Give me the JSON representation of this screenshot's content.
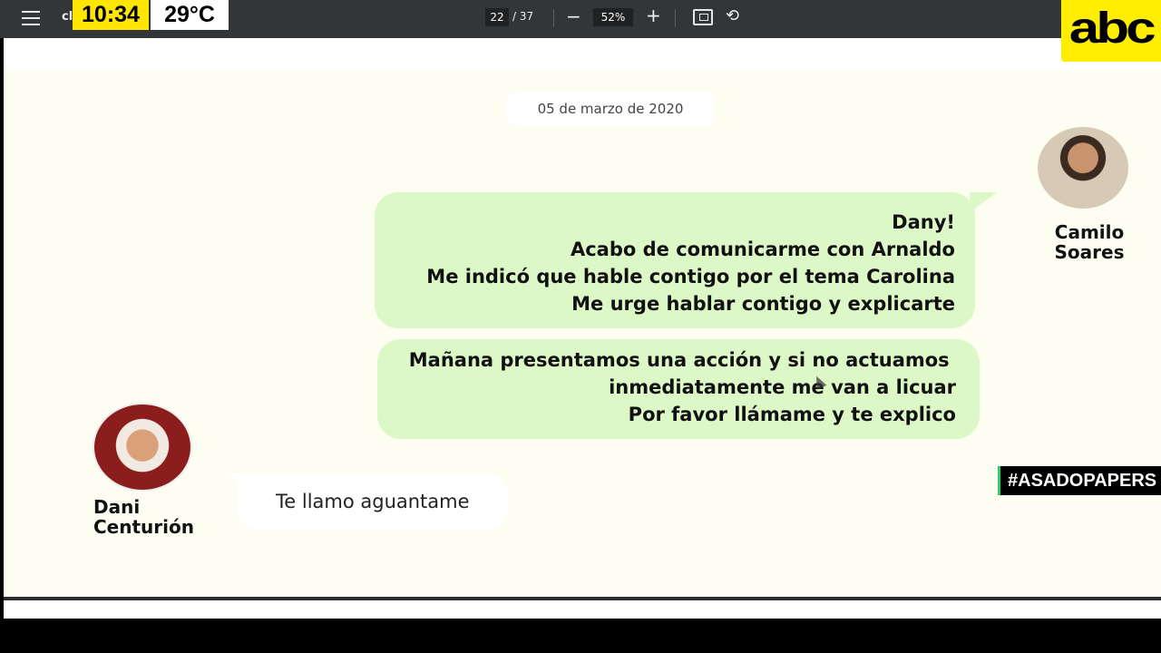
{
  "toolbar": {
    "doc_title_stub": "cl",
    "current_page": "22",
    "page_total": "/ 37",
    "zoom_minus": "−",
    "zoom_level": "52%",
    "zoom_plus": "+",
    "rotate_glyph": "⟲"
  },
  "overlay": {
    "time": "10:34",
    "temperature": "29°C",
    "logo": "abc",
    "hashtag": "#ASADOPAPERS"
  },
  "chat": {
    "date": "05 de marzo de 2020",
    "sender_right": {
      "name_line1": "Camilo",
      "name_line2": "Soares"
    },
    "sender_left": {
      "name_line1": "Dani",
      "name_line2": "Centurión"
    },
    "messages_out": [
      {
        "lines": [
          "Dany!",
          "Acabo de comunicarme con Arnaldo",
          "Me indicó que hable contigo por el tema Carolina",
          "Me urge hablar contigo y explicarte"
        ]
      },
      {
        "lines": [
          "Mañana presentamos una acción y si no actuamos ",
          "inmediatamente me van a licuar",
          "Por favor llámame y te explico"
        ]
      }
    ],
    "messages_in": [
      {
        "text": "Te llamo aguantame"
      }
    ]
  }
}
